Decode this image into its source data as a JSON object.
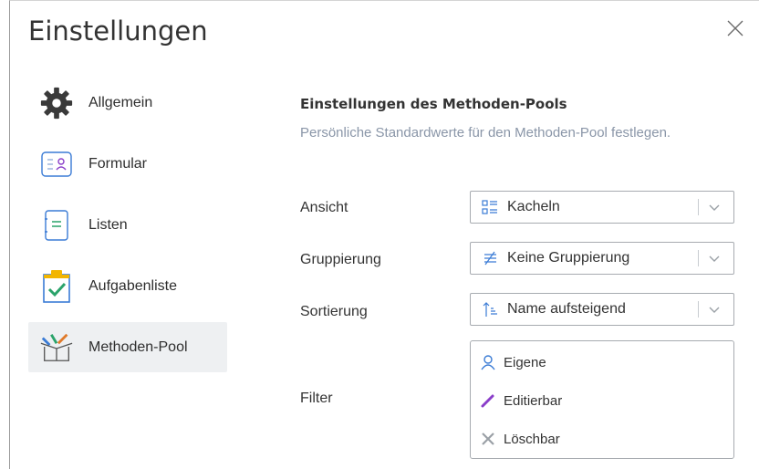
{
  "dialog": {
    "title": "Einstellungen",
    "close_icon": "close-icon"
  },
  "nav": {
    "items": [
      {
        "label": "Allgemein",
        "icon": "gear-icon",
        "active": false
      },
      {
        "label": "Formular",
        "icon": "form-icon",
        "active": false
      },
      {
        "label": "Listen",
        "icon": "list-icon",
        "active": false
      },
      {
        "label": "Aufgabenliste",
        "icon": "clipboard-check-icon",
        "active": false
      },
      {
        "label": "Methoden-Pool",
        "icon": "method-pool-box-icon",
        "active": true
      }
    ]
  },
  "main": {
    "section_title": "Einstellungen des Methoden-Pools",
    "section_description": "Persönliche Standardwerte für den Methoden-Pool festlegen.",
    "ansicht": {
      "label": "Ansicht",
      "value": "Kacheln",
      "icon": "tiles-icon"
    },
    "gruppierung": {
      "label": "Gruppierung",
      "value": "Keine Gruppierung",
      "icon": "no-grouping-icon"
    },
    "sortierung": {
      "label": "Sortierung",
      "value": "Name aufsteigend",
      "icon": "sort-ascending-icon"
    },
    "filter": {
      "label": "Filter",
      "options": [
        {
          "label": "Eigene",
          "icon": "user-icon"
        },
        {
          "label": "Editierbar",
          "icon": "pencil-icon"
        },
        {
          "label": "Löschbar",
          "icon": "x-icon"
        }
      ]
    }
  },
  "colors": {
    "accent_blue": "#3a7bd5",
    "description_text": "#8a96a8",
    "active_nav_bg": "#eef0f2",
    "purple": "#8a3ec9"
  }
}
